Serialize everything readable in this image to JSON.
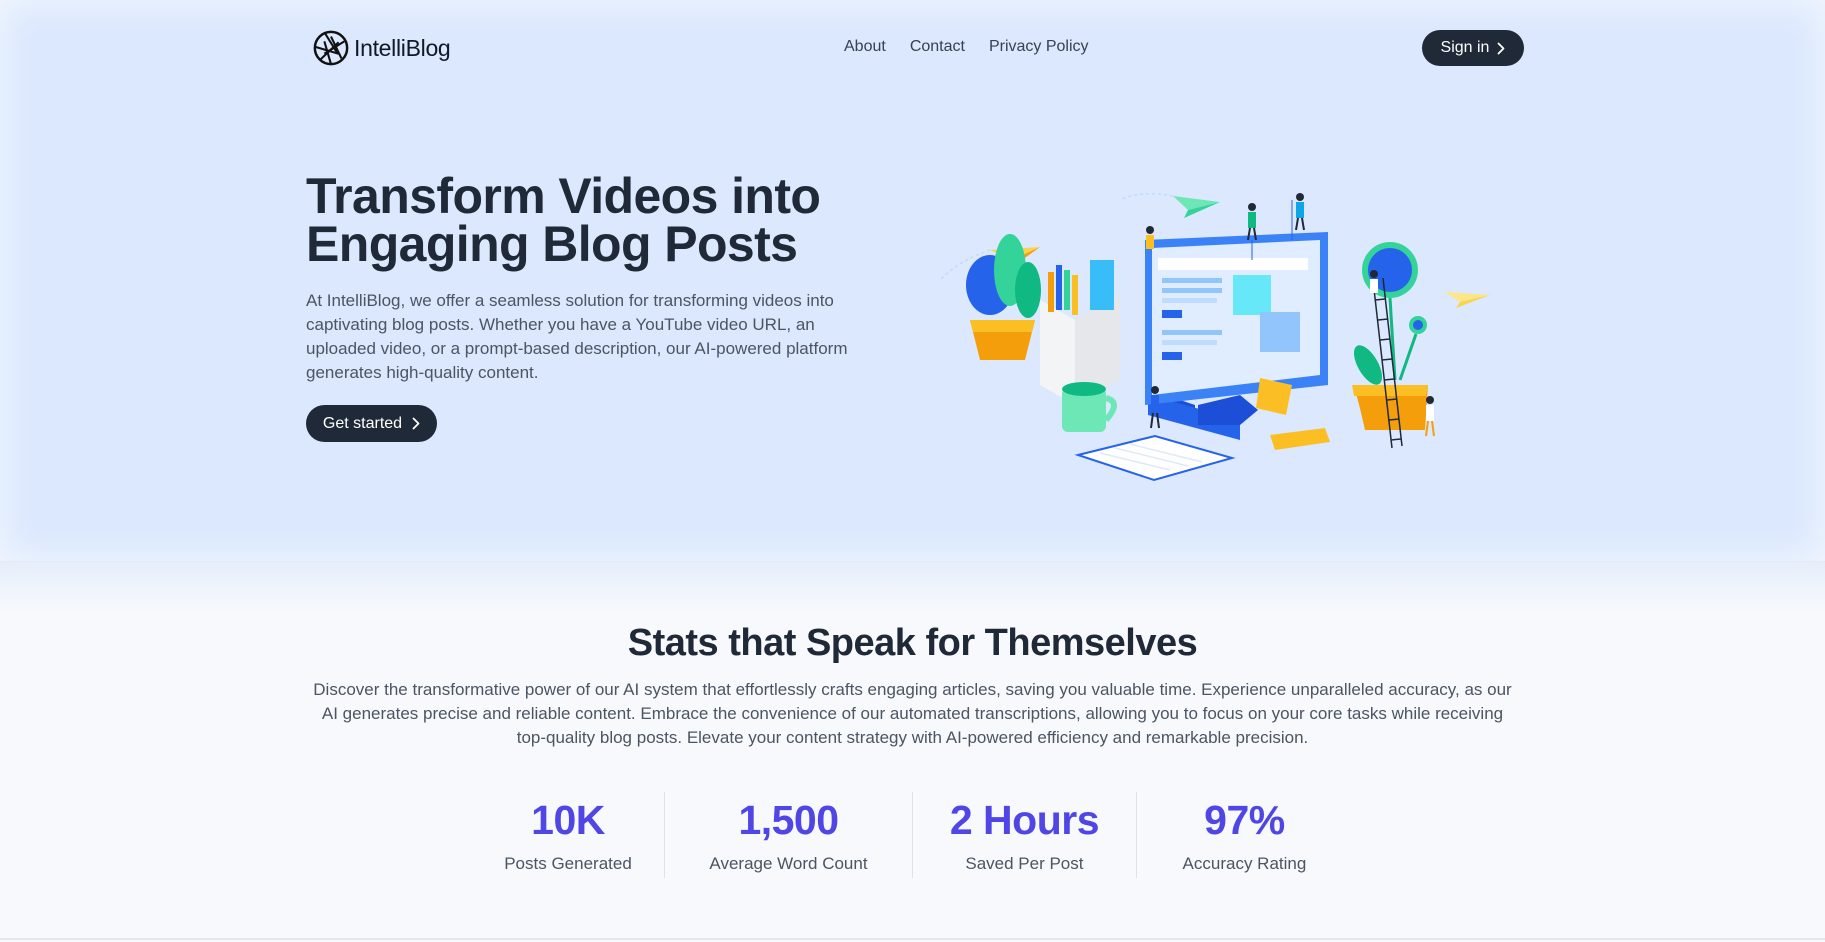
{
  "header": {
    "brand": "IntelliBlog",
    "logo_icon": "aperture-icon",
    "nav": [
      {
        "label": "About"
      },
      {
        "label": "Contact"
      },
      {
        "label": "Privacy Policy"
      }
    ],
    "signin_label": "Sign in"
  },
  "hero": {
    "title": "Transform Videos into Engaging Blog Posts",
    "description": "At IntelliBlog, we offer a seamless solution for transforming videos into captivating blog posts. Whether you have a YouTube video URL, an uploaded video, or a prompt-based description, our AI-powered platform generates high-quality content.",
    "cta_label": "Get started",
    "illustration_icon": "workspace-illustration"
  },
  "stats": {
    "title": "Stats that Speak for Themselves",
    "description": "Discover the transformative power of our AI system that effortlessly crafts engaging articles, saving you valuable time. Experience unparalleled accuracy, as our AI generates precise and reliable content. Embrace the convenience of our automated transcriptions, allowing you to focus on your core tasks while receiving top-quality blog posts. Elevate your content strategy with AI-powered efficiency and remarkable precision.",
    "items": [
      {
        "value": "10K",
        "label": "Posts Generated"
      },
      {
        "value": "1,500",
        "label": "Average Word Count"
      },
      {
        "value": "2 Hours",
        "label": "Saved Per Post"
      },
      {
        "value": "97%",
        "label": "Accuracy Rating"
      }
    ]
  },
  "colors": {
    "hero_bg": "#dbe8fd",
    "dark": "#1f2937",
    "accent": "#4f46e5",
    "text_muted": "#4b5563"
  }
}
